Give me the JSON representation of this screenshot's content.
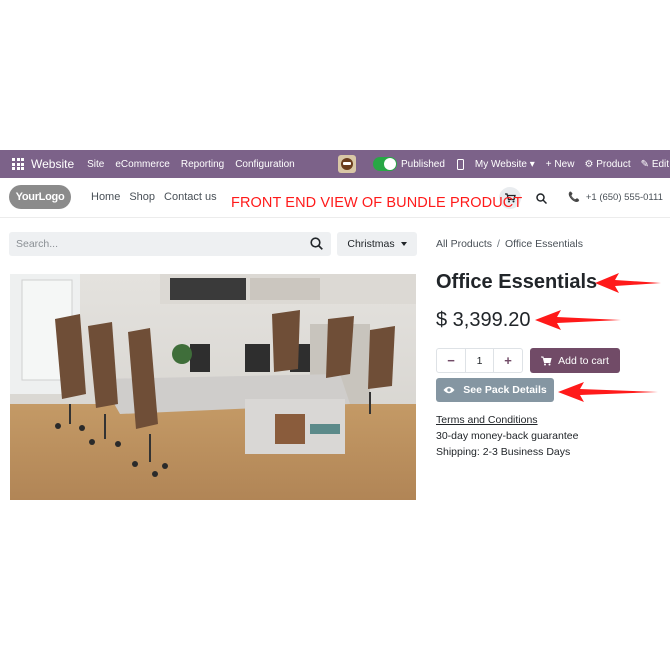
{
  "admin_bar": {
    "app_name": "Website",
    "menu": [
      "Site",
      "eCommerce",
      "Reporting",
      "Configuration"
    ],
    "published_label": "Published",
    "my_website_label": "My Website",
    "new_label": "New",
    "product_label": "Product",
    "edit_label": "Edit",
    "bar_color": "#7c6289"
  },
  "header": {
    "logo_text": "YourLogo",
    "nav": [
      "Home",
      "Shop",
      "Contact us"
    ],
    "phone": "+1 (650) 555-0111"
  },
  "annotation": {
    "text": "FRONT END VIEW OF BUNDLE PRODUCT",
    "color": "#ff1a1a"
  },
  "search": {
    "placeholder": "Search...",
    "filter_label": "Christmas"
  },
  "breadcrumb": {
    "parent": "All Products",
    "separator": "/",
    "current": "Office Essentials"
  },
  "product": {
    "name": "Office Essentials",
    "price": "$ 3,399.20",
    "quantity": "1",
    "add_to_cart_label": "Add to cart",
    "pack_details_label": "See Pack Details",
    "terms_label": "Terms and Conditions",
    "guarantee": "30-day money-back guarantee",
    "shipping": "Shipping: 2-3 Business Days",
    "image_icon": "office-desk-chairs-photo",
    "primary_color": "#714b67",
    "pack_button_color": "#8596a2"
  }
}
